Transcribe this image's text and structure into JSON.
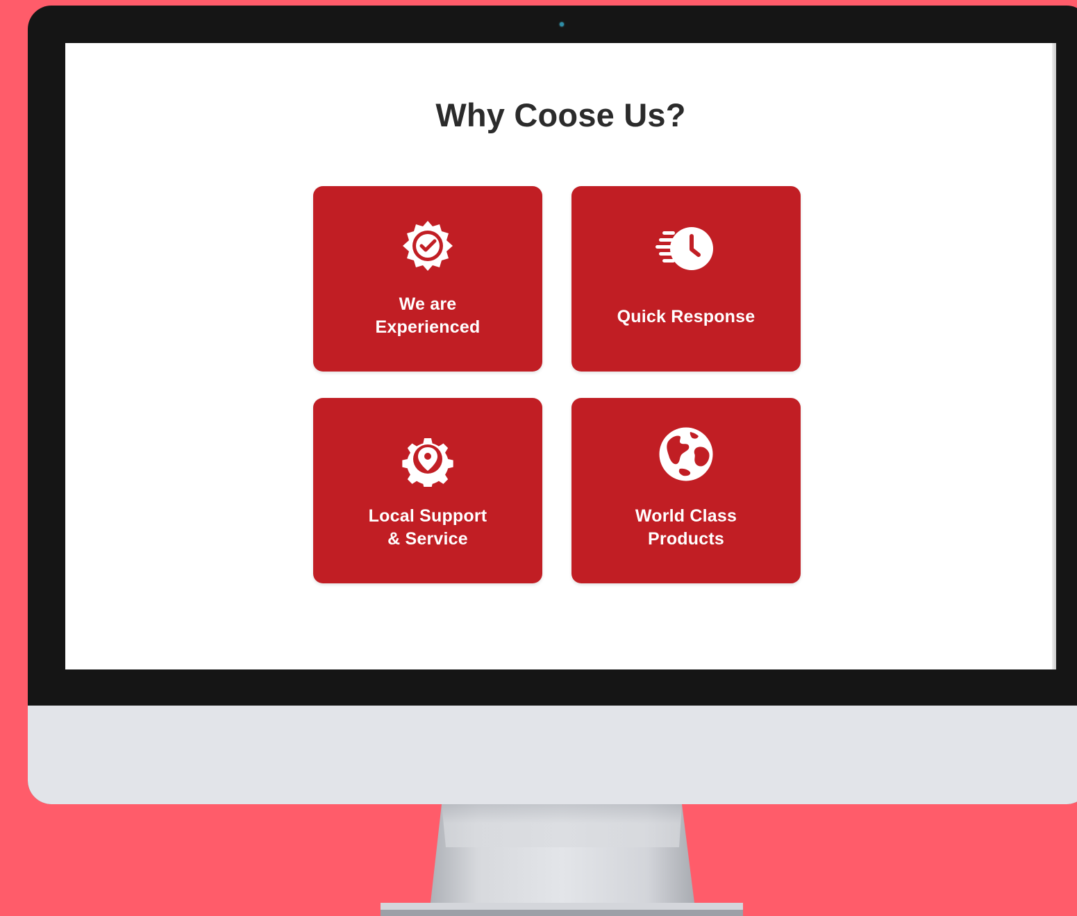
{
  "page": {
    "title": "Why Coose Us?"
  },
  "features": [
    {
      "label": "We are\nExperienced",
      "icon": "badge-check-icon"
    },
    {
      "label": "Quick Response",
      "icon": "fast-clock-icon"
    },
    {
      "label": "Local Support\n& Service",
      "icon": "gear-location-icon"
    },
    {
      "label": "World Class\nProducts",
      "icon": "globe-icon"
    }
  ],
  "colors": {
    "background": "#ff5c6a",
    "card": "#c11e24",
    "bezel": "#151515",
    "chin": "#e2e4e9",
    "stand": "#cfd1d6",
    "title_text": "#2b2b2b"
  }
}
